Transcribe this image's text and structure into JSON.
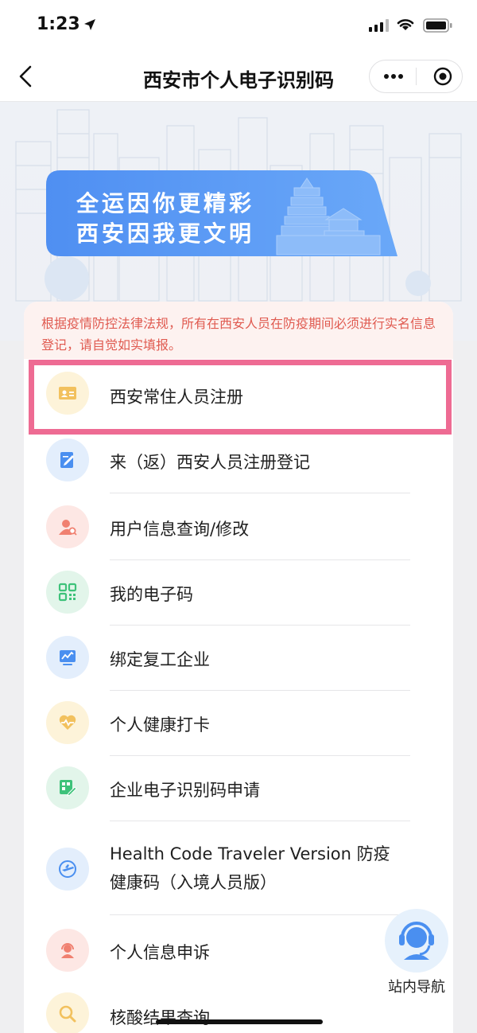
{
  "status_bar": {
    "time": "1:23"
  },
  "nav": {
    "title": "西安市个人电子识别码"
  },
  "banner": {
    "line1": "全运因你更精彩",
    "line2": "西安因我更文明"
  },
  "notice": {
    "text": "根据疫情防控法律法规，所有在西安人员在防疫期间必须进行实名信息登记，请自觉如实填报。"
  },
  "menu": [
    {
      "label": "西安常住人员注册",
      "icon": "id-card-icon",
      "bg": "#fdf3d9",
      "fg": "#f0c060"
    },
    {
      "label": "来（返）西安人员注册登记",
      "icon": "edit-document-icon",
      "bg": "#e3eefc",
      "fg": "#4a8ff0"
    },
    {
      "label": "用户信息查询/修改",
      "icon": "user-search-icon",
      "bg": "#fde7e4",
      "fg": "#f08070"
    },
    {
      "label": "我的电子码",
      "icon": "qr-code-icon",
      "bg": "#e2f5ea",
      "fg": "#3ec27a"
    },
    {
      "label": "绑定复工企业",
      "icon": "chart-monitor-icon",
      "bg": "#e3eefc",
      "fg": "#4a8ff0"
    },
    {
      "label": "个人健康打卡",
      "icon": "heart-pulse-icon",
      "bg": "#fdf3d9",
      "fg": "#f0c060"
    },
    {
      "label": "企业电子识别码申请",
      "icon": "qr-edit-icon",
      "bg": "#e2f5ea",
      "fg": "#3ec27a"
    },
    {
      "label_line1": "Health Code Traveler Version 防疫",
      "label_line2": "健康码（入境人员版）",
      "icon": "plane-icon",
      "bg": "#e3eefc",
      "fg": "#4a8ff0"
    },
    {
      "label": "个人信息申诉",
      "icon": "headset-user-icon",
      "bg": "#fde7e4",
      "fg": "#f08070"
    },
    {
      "label": "核酸结果查询",
      "icon": "magnifier-icon",
      "bg": "#fdf3d9",
      "fg": "#f0c060"
    }
  ],
  "help": {
    "label": "站内导航"
  }
}
